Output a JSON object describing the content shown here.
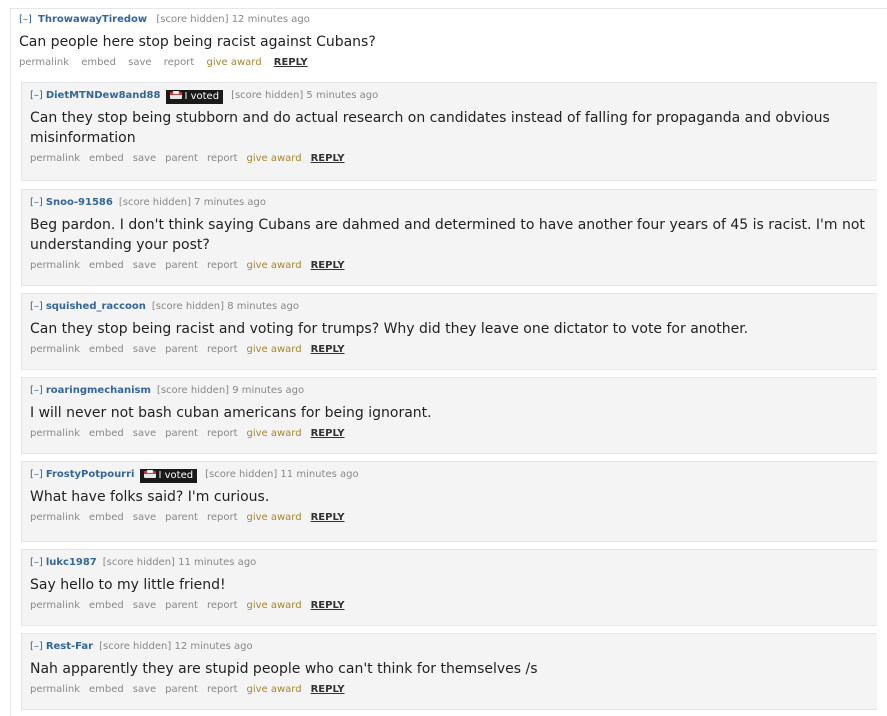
{
  "parent": {
    "expand": "[–]",
    "author": "ThrowawayTiredow",
    "score": "[score hidden]",
    "time": "12 minutes ago",
    "body": "Can people here stop being racist against Cubans?",
    "buttons": {
      "permalink": "permalink",
      "embed": "embed",
      "save": "save",
      "report": "report",
      "award": "give award",
      "reply": "REPLY"
    }
  },
  "child_buttons": {
    "permalink": "permalink",
    "embed": "embed",
    "save": "save",
    "parent": "parent",
    "report": "report",
    "award": "give award",
    "reply": "REPLY"
  },
  "flair_text": "I voted",
  "replies": [
    {
      "expand": "[–]",
      "author": "DietMTNDew8and88",
      "flair": true,
      "score": "[score hidden]",
      "time": "5 minutes ago",
      "body": "Can they stop being stubborn and do actual research on candidates instead of falling for propaganda and obvious misinformation"
    },
    {
      "expand": "[–]",
      "author": "Snoo-91586",
      "flair": false,
      "score": "[score hidden]",
      "time": "7 minutes ago",
      "body": "Beg pardon. I don't think saying Cubans are dahmed and determined to have another four years of 45 is racist. I'm not understanding your post?"
    },
    {
      "expand": "[–]",
      "author": "squished_raccoon",
      "flair": false,
      "score": "[score hidden]",
      "time": "8 minutes ago",
      "body": "Can they stop being racist and voting for trumps? Why did they leave one dictator to vote for another."
    },
    {
      "expand": "[–]",
      "author": "roaringmechanism",
      "flair": false,
      "score": "[score hidden]",
      "time": "9 minutes ago",
      "body": "I will never not bash cuban americans for being ignorant."
    },
    {
      "expand": "[–]",
      "author": "FrostyPotpourri",
      "flair": true,
      "score": "[score hidden]",
      "time": "11 minutes ago",
      "body": "What have folks said? I'm curious."
    },
    {
      "expand": "[–]",
      "author": "lukc1987",
      "flair": false,
      "score": "[score hidden]",
      "time": "11 minutes ago",
      "body": "Say hello to my little friend!"
    },
    {
      "expand": "[–]",
      "author": "Rest-Far",
      "flair": false,
      "score": "[score hidden]",
      "time": "12 minutes ago",
      "body": "Nah apparently they are stupid people who can't think for themselves /s"
    }
  ]
}
